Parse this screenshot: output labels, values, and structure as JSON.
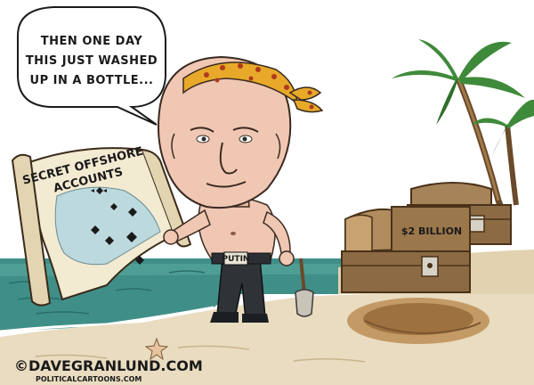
{
  "speech_bubble": {
    "line1": "THEN ONE DAY",
    "line2": "THIS JUST WASHED",
    "line3": "UP IN A BOTTLE..."
  },
  "map": {
    "title_line1": "SECRET OFFSHORE",
    "title_line2": "ACCOUNTS"
  },
  "chest_label": "$2 BILLION",
  "belt_label": "PUTIN",
  "signature": {
    "name": "©DAVEGRANLUND.COM",
    "site": "POLITICALCARTOONS.COM"
  },
  "colors": {
    "sea": "#3f8f88",
    "sand": "#e9dcc0",
    "bandana": "#e8a92a",
    "skin": "#f0c7b3",
    "chest": "#8c6a44",
    "palm": "#3f8a3a"
  }
}
